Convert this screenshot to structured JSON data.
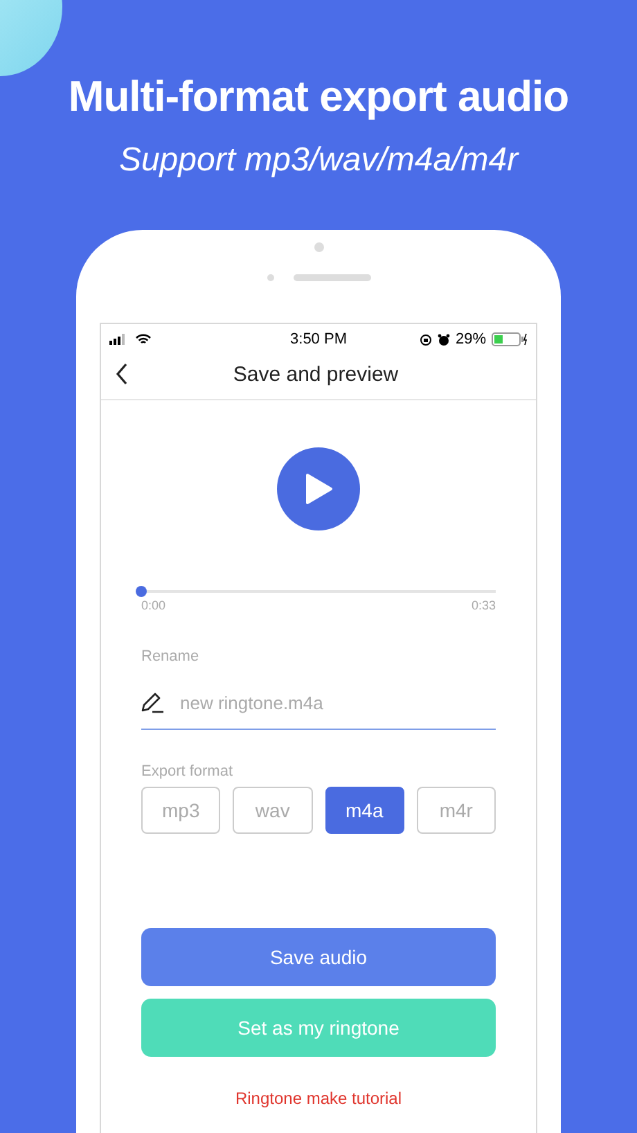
{
  "headline": "Multi-format export audio",
  "subtitle": "Support mp3/wav/m4a/m4r",
  "status_bar": {
    "time": "3:50 PM",
    "battery": "29%"
  },
  "nav": {
    "title": "Save and preview"
  },
  "player": {
    "level": 0,
    "start": "0:00",
    "end": "0:33"
  },
  "rename": {
    "label": "Rename",
    "placeholder": "new ringtone.m4a"
  },
  "export_format": {
    "label": "Export format",
    "options": [
      {
        "label": "mp3",
        "selected": false
      },
      {
        "label": "wav",
        "selected": false
      },
      {
        "label": "m4a",
        "selected": true
      },
      {
        "label": "m4r",
        "selected": false
      }
    ]
  },
  "buttons": [
    {
      "label": "Save audio",
      "kind": "primary"
    },
    {
      "label": "Set as my ringtone",
      "kind": "secondary"
    }
  ],
  "link": "Ringtone make tutorial"
}
